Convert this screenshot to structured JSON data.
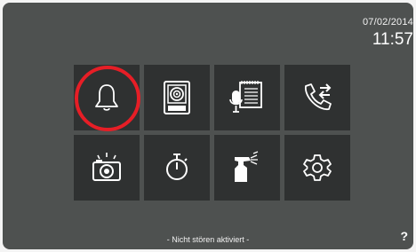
{
  "header": {
    "date": "07/02/2014",
    "time": "11:57"
  },
  "menu": {
    "tiles": [
      {
        "name": "tile-ring-tones",
        "icon": "bell-icon"
      },
      {
        "name": "tile-entrance-panel",
        "icon": "intercom-panel-icon"
      },
      {
        "name": "tile-voice-memo",
        "icon": "microphone-notepad-icon"
      },
      {
        "name": "tile-call-forwarding",
        "icon": "phone-transfer-icon"
      },
      {
        "name": "tile-photo-memory",
        "icon": "camera-icon"
      },
      {
        "name": "tile-timer",
        "icon": "stopwatch-icon"
      },
      {
        "name": "tile-cleaning-mode",
        "icon": "spray-bottle-icon"
      },
      {
        "name": "tile-settings",
        "icon": "gear-icon"
      }
    ],
    "highlight_color": "#e61e26"
  },
  "footer": {
    "status_text": "- Nicht stören aktiviert -",
    "help_label": "?"
  },
  "colors": {
    "screen_bg": "#4e5150",
    "tile_bg": "#2f3131",
    "icon": "#ffffff"
  }
}
